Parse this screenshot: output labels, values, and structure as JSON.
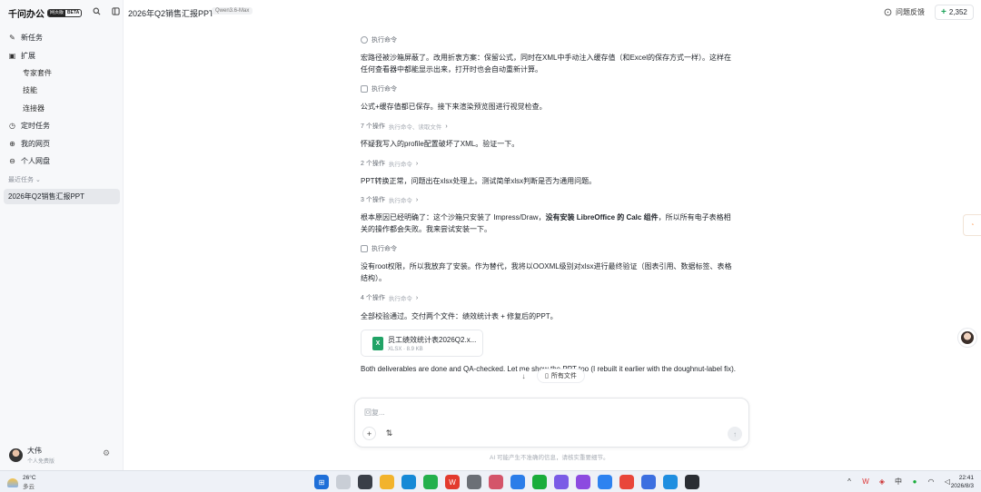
{
  "sidebar": {
    "brand": "千问办公",
    "badge_a": "网页版",
    "badge_b": "BETA",
    "nav": [
      {
        "label": "新任务"
      },
      {
        "label": "扩展"
      },
      {
        "label": "专家套件"
      },
      {
        "label": "技能"
      },
      {
        "label": "连接器"
      },
      {
        "label": "定时任务"
      },
      {
        "label": "我的网页"
      },
      {
        "label": "个人网盘"
      }
    ],
    "recent_label": "最近任务",
    "recent_item": "2026年Q2销售汇报PPT",
    "user_name": "大伟",
    "user_sub": "个人免费版"
  },
  "header": {
    "title": "2026年Q2销售汇报PPT",
    "model": "Qwen3.6-Max",
    "feedback": "问题反馈",
    "counter": "2,352"
  },
  "chat": {
    "s1": "执行命令",
    "p1": "宏路径被沙箱屏蔽了。改用折衷方案：保留公式，同时在XML中手动注入缓存值（和Excel的保存方式一样）。这样在任何查看器中都能显示出来，打开时也会自动重新计算。",
    "s2": "执行命令",
    "p2": "公式+缓存值都已保存。接下来渲染预览图进行视觉检查。",
    "s3": "7 个操作",
    "s3_detail": "执行命令、读取文件",
    "p3": "怀疑我写入的profile配置破坏了XML。验证一下。",
    "s4": "2 个操作",
    "s4_detail": "执行命令",
    "p4": "PPT转换正常，问题出在xlsx处理上。测试简单xlsx判断是否为通用问题。",
    "s5": "3 个操作",
    "s5_detail": "执行命令",
    "p5_a": "根本原因已经明确了：这个沙箱只安装了 Impress/Draw，",
    "p5_b": "没有安装 LibreOffice 的 Calc 组件",
    "p5_c": "，所以所有电子表格相关的操作都会失败。我来尝试安装一下。",
    "s6": "执行命令",
    "p6": "没有root权限，所以我放弃了安装。作为替代，我将以OOXML级别对xlsx进行最终验证（图表引用、数据标签、表格结构）。",
    "s7": "4 个操作",
    "s7_detail": "执行命令",
    "p7": "全部校验通过。交付两个文件：绩效统计表 + 修复后的PPT。",
    "file_name": "员工绩效统计表2026Q2.x...",
    "file_meta": "XLSX · 8.9 KB",
    "p8": "Both deliverables are done and QA-checked. Let me show the PPT too (I rebuilt it earlier with the doughnut-label fix).",
    "all_files": "所有文件"
  },
  "input": {
    "placeholder": "回复...",
    "disclaimer": "AI 可能产生不准确的信息，请核实重要细节。"
  },
  "taskbar": {
    "temp": "26°C",
    "weather": "多云",
    "ime": "中",
    "time": "22:41",
    "date": "2026/8/3"
  }
}
